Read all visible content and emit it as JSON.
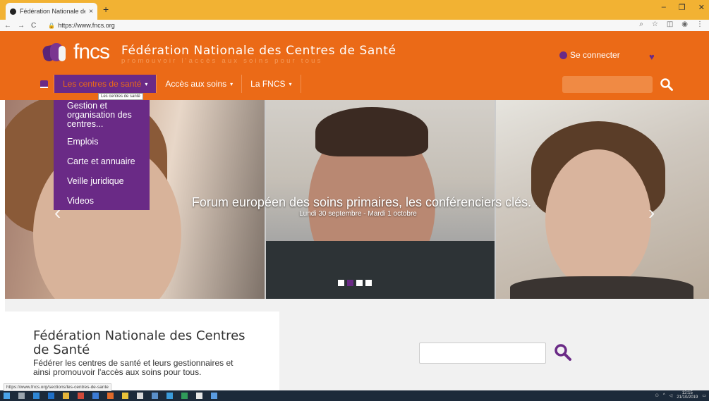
{
  "browser": {
    "tab_title": "Fédération Nationale des Centre",
    "tab_close": "×",
    "new_tab": "+",
    "window_minimize": "–",
    "window_maximize": "❐",
    "window_close": "✕",
    "back": "←",
    "forward": "→",
    "reload": "C",
    "url": "https://www.fncs.org",
    "lock": "🔒",
    "status_url": "https://www.fncs.org/sections/les-centres-de-sante"
  },
  "header": {
    "logo_text": "fncs",
    "site_name": "Fédération Nationale des Centres de Santé",
    "tagline": "promouvoir l'accès aux soins pour tous",
    "login_label": "Se connecter",
    "heart": "♥"
  },
  "nav": {
    "items": [
      {
        "label": "Les centres de santé"
      },
      {
        "label": "Accès aux soins"
      },
      {
        "label": "La FNCS"
      }
    ],
    "tooltip": "Les centres de santé",
    "caret": "▾"
  },
  "dropdown": {
    "items": [
      {
        "label": "Gestion et organisation des centres..."
      },
      {
        "label": "Emplois"
      },
      {
        "label": "Carte et annuaire"
      },
      {
        "label": "Veille juridique"
      },
      {
        "label": "Videos"
      }
    ]
  },
  "hero": {
    "title": "Forum européen des soins primaires, les conférenciers clés.",
    "subtitle": "Lundi 30 septembre - Mardi 1 octobre",
    "prev": "‹",
    "next": "›",
    "slide_count": 4,
    "active_slide": 2
  },
  "intro": {
    "title": "Fédération Nationale des Centres de Santé",
    "description": "Fédérer les centres de santé et leurs gestionnaires et ainsi promouvoir l'accès aux soins pour tous."
  },
  "taskbar": {
    "time": "12:15",
    "date": "21/10/2019"
  },
  "colors": {
    "orange": "#eb6a17",
    "purple": "#6a2a86",
    "chrome_tabbar": "#f2b233"
  }
}
